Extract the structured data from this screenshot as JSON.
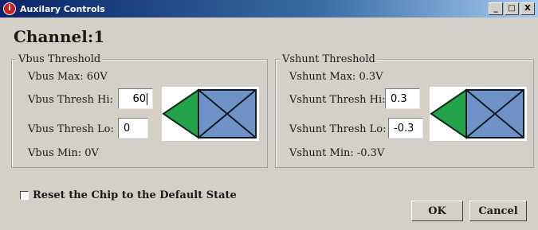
{
  "window": {
    "title": "Auxilary Controls",
    "minimize": "_",
    "maximize": "□",
    "close": "X"
  },
  "channel_label": "Channel:1",
  "vbus": {
    "legend": "Vbus Threshold",
    "max_label": "Vbus Max: 60V",
    "hi_label": "Vbus Thresh Hi:",
    "hi_value": "60",
    "lo_label": "Vbus Thresh Lo:",
    "lo_value": "0",
    "min_label": "Vbus Min: 0V"
  },
  "vshunt": {
    "legend": "Vshunt Threshold",
    "max_label": "Vshunt Max: 0.3V",
    "hi_label": "Vshunt Thresh Hi:",
    "hi_value": "0.3",
    "lo_label": "Vshunt Thresh Lo:",
    "lo_value": "-0.3",
    "min_label": "Vshunt Min: -0.3V"
  },
  "reset_label": "Reset the Chip to the Default State",
  "buttons": {
    "ok": "OK",
    "cancel": "Cancel"
  },
  "colors": {
    "triangle": "#22a34a",
    "box": "#6f93c6",
    "title_bar": "#0a246a"
  }
}
